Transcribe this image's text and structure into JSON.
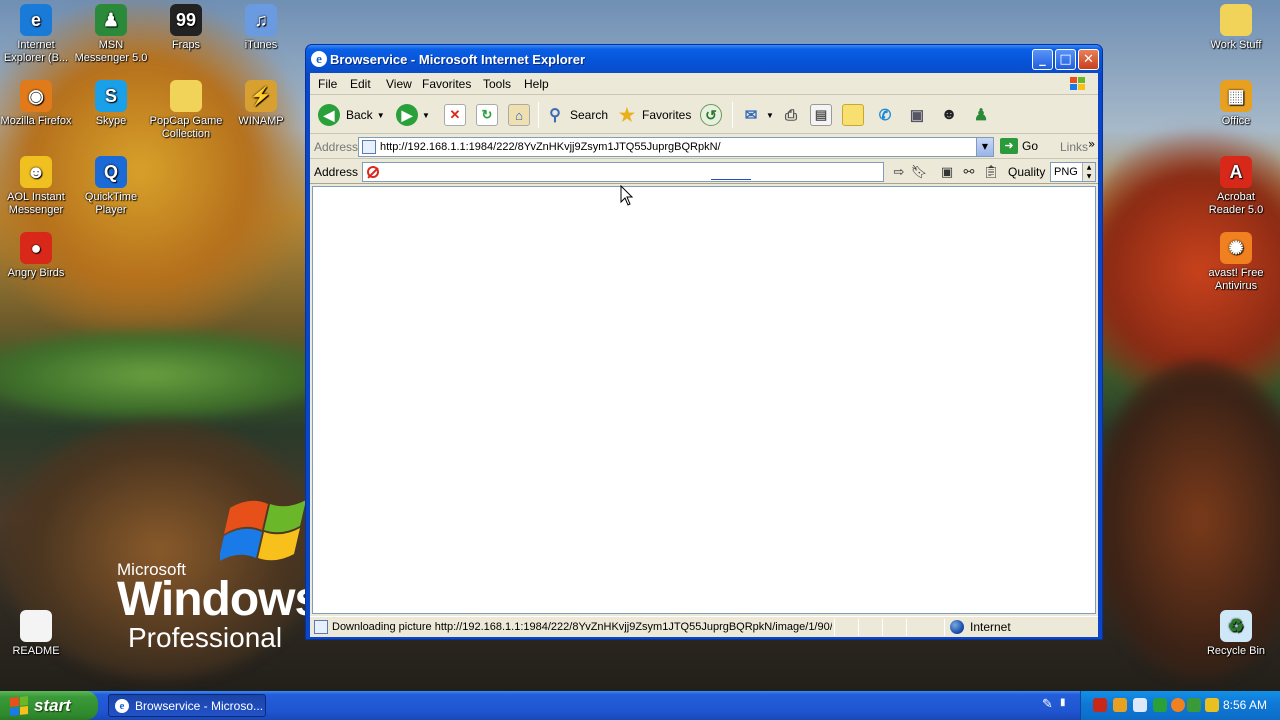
{
  "desktop": {
    "icons_left": [
      {
        "label": "Internet Explorer (B...",
        "icon": "internet-explorer-icon",
        "color": "#1a7ad8",
        "glyph": "e"
      },
      {
        "label": "MSN Messenger 5.0",
        "icon": "msn-messenger-icon",
        "color": "#2a8a3a",
        "glyph": "♟"
      },
      {
        "label": "Fraps",
        "icon": "fraps-icon",
        "color": "#222222",
        "glyph": "99"
      },
      {
        "label": "iTunes",
        "icon": "itunes-icon",
        "color": "#6a9ae0",
        "glyph": "♫"
      },
      {
        "label": "Mozilla Firefox",
        "icon": "firefox-icon",
        "color": "#e07a1a",
        "glyph": "◉"
      },
      {
        "label": "Skype",
        "icon": "skype-icon",
        "color": "#1aa0e8",
        "glyph": "S"
      },
      {
        "label": "PopCap Game Collection",
        "icon": "folder-icon",
        "color": "#f2d35a",
        "glyph": ""
      },
      {
        "label": "WINAMP",
        "icon": "winamp-icon",
        "color": "#d8a030",
        "glyph": "⚡"
      },
      {
        "label": "AOL Instant Messenger",
        "icon": "aim-icon",
        "color": "#f0c020",
        "glyph": "☻"
      },
      {
        "label": "QuickTime Player",
        "icon": "quicktime-icon",
        "color": "#1a6ad8",
        "glyph": "Q"
      },
      {
        "label": "Angry Birds",
        "icon": "angry-birds-icon",
        "color": "#d8281a",
        "glyph": "●"
      },
      {
        "label": "README",
        "icon": "text-document-icon",
        "color": "#f4f4f4",
        "glyph": ""
      }
    ],
    "icons_right": [
      {
        "label": "Work Stuff",
        "icon": "folder-icon",
        "color": "#f2d35a",
        "glyph": ""
      },
      {
        "label": "Office",
        "icon": "office-icon",
        "color": "#e8a020",
        "glyph": "▦"
      },
      {
        "label": "Acrobat Reader 5.0",
        "icon": "acrobat-icon",
        "color": "#d8281a",
        "glyph": "A"
      },
      {
        "label": "avast! Free Antivirus",
        "icon": "avast-icon",
        "color": "#f08020",
        "glyph": "✺"
      },
      {
        "label": "Recycle Bin",
        "icon": "recycle-bin-icon",
        "color": "#cfe8f8",
        "glyph": "♻"
      }
    ],
    "xp_logo": {
      "brand": "Microsoft",
      "product": "Windows",
      "edition": "Professional"
    }
  },
  "window": {
    "title": "Browservice - Microsoft Internet Explorer",
    "controls": {
      "minimize": "_",
      "maximize": "□",
      "close": "✕"
    },
    "menu": [
      "File",
      "Edit",
      "View",
      "Favorites",
      "Tools",
      "Help"
    ],
    "toolbar": {
      "back_label": "Back",
      "search_label": "Search",
      "favorites_label": "Favorites"
    },
    "address": {
      "label": "Address",
      "url": "http://192.168.1.1:1984/222/8YvZnHKvjj9Zsym1JTQ55JuprgBQRpkN/",
      "go_label": "Go",
      "links_label": "Links"
    },
    "browservice_bar": {
      "label": "Address",
      "value": "",
      "quality_label": "Quality",
      "quality_value": "PNG"
    },
    "status": {
      "text": "Downloading picture http://192.168.1.1:1984/222/8YvZnHKvjj9Zsym1JTQ55JuprgBQRpkN/image/1/90/",
      "zone": "Internet"
    }
  },
  "taskbar": {
    "start_label": "start",
    "task_item": "Browservice - Microso...",
    "clock": "8:56 AM"
  }
}
